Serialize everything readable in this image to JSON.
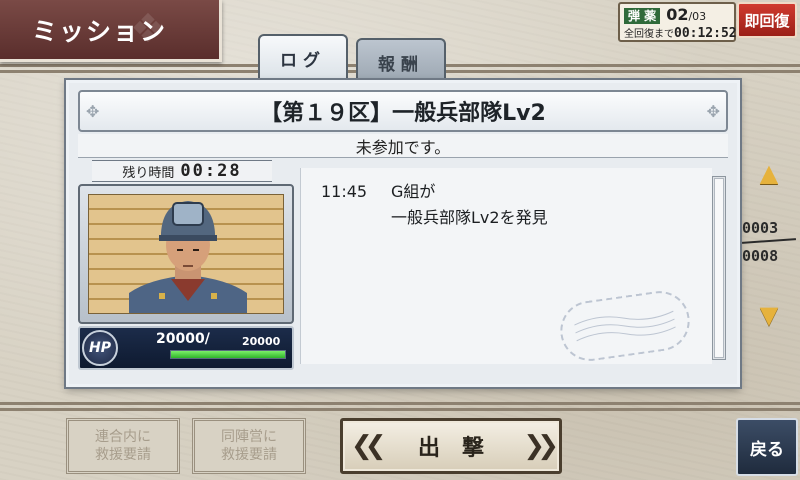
{
  "header": {
    "title": "ミッション"
  },
  "ammo": {
    "label": "弾 薬",
    "current": "02",
    "max": "/03",
    "recovery_label": "全回復まで",
    "recovery_time": "00:12:52",
    "recover_button": "即回復"
  },
  "tabs": [
    {
      "label": "ログ",
      "active": true
    },
    {
      "label": "報酬",
      "active": false
    }
  ],
  "mission": {
    "title": "【第１９区】一般兵部隊Lv2",
    "status": "未参加です。",
    "time_left_label": "残り時間",
    "time_left": "00:28"
  },
  "enemy": {
    "hp_icon": "HP",
    "hp_current": "20000/",
    "hp_max": "20000",
    "hp_fraction": 1.0
  },
  "log": [
    {
      "time": "11:45",
      "text": "G組が"
    },
    {
      "time": "",
      "text": "一般兵部隊Lv2を発見"
    }
  ],
  "pager": {
    "current": "0003",
    "total": "0008"
  },
  "buttons": {
    "help_alliance_line1": "連合内に",
    "help_alliance_line2": "救援要請",
    "help_camp_line1": "同陣営に",
    "help_camp_line2": "救援要請",
    "sortie": "出撃",
    "back": "戻る"
  },
  "colors": {
    "accent_red": "#c4312a",
    "hp_green": "#3fc436",
    "arrow_gold": "#e6b23c"
  }
}
